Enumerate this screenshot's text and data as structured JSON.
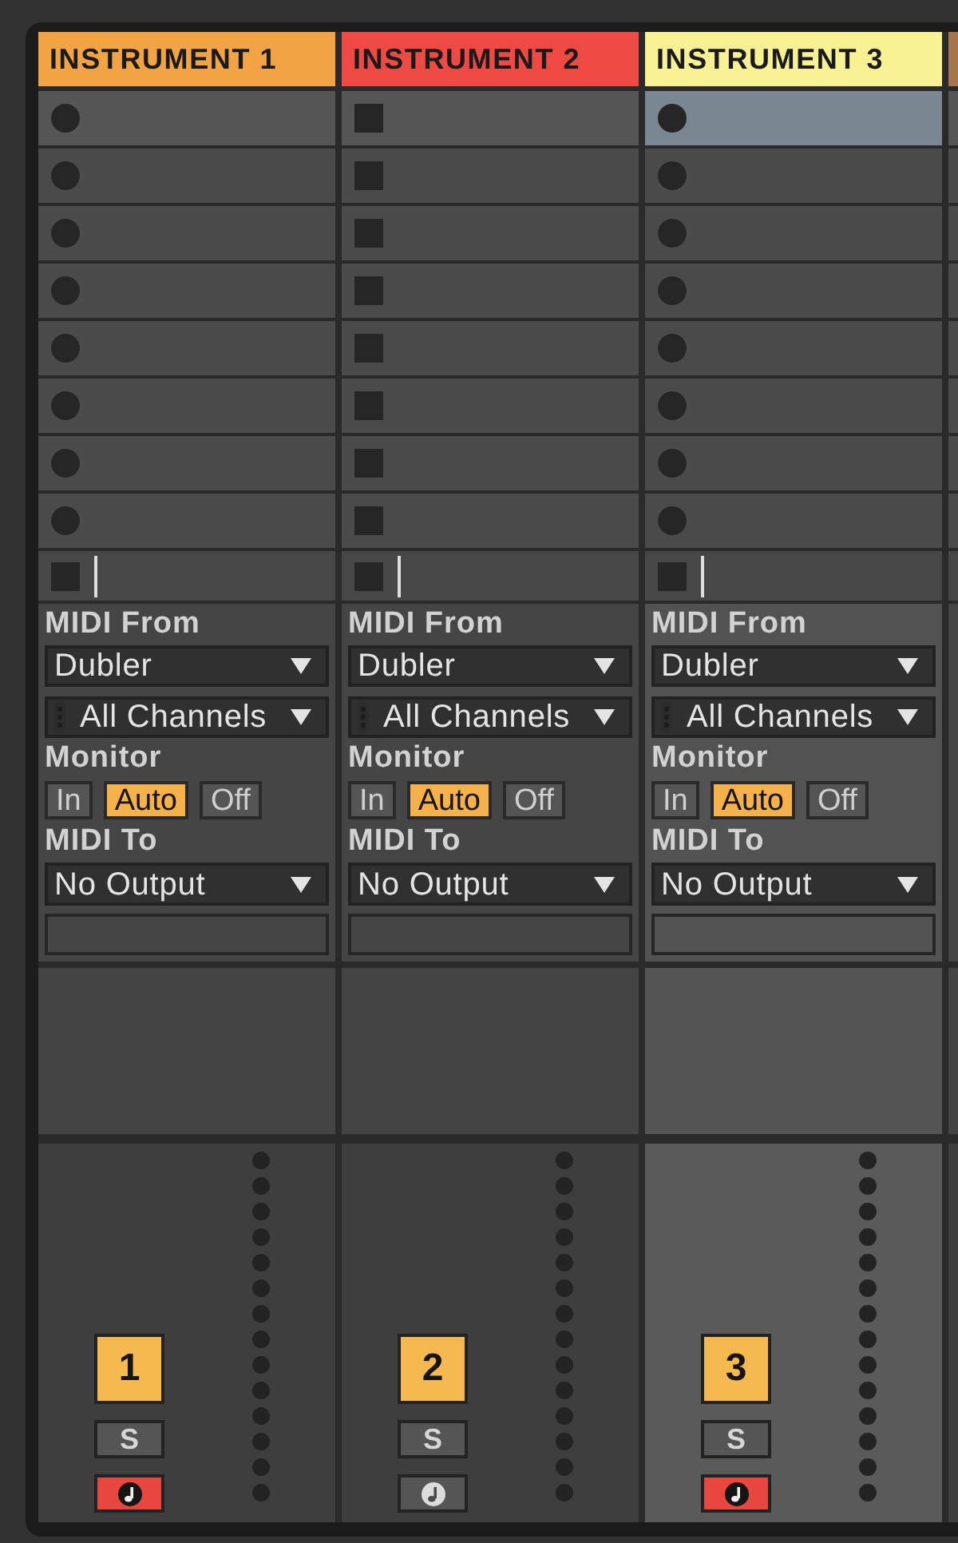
{
  "tracks": [
    {
      "kind": "track",
      "name": "INSTRUMENT 1",
      "color": "#f2a444",
      "selected": false,
      "slots": [
        {
          "selected": false
        },
        {
          "selected": false
        },
        {
          "selected": false
        },
        {
          "selected": false
        },
        {
          "selected": false
        },
        {
          "selected": false
        },
        {
          "selected": false
        },
        {
          "selected": false
        }
      ],
      "io": {
        "midi_from_label": "MIDI From",
        "midi_from": "Dubler",
        "channel": "All Channels",
        "monitor_label": "Monitor",
        "monitor": [
          {
            "label": "In",
            "selected": false
          },
          {
            "label": "Auto",
            "selected": true
          },
          {
            "label": "Off",
            "selected": false
          }
        ],
        "midi_to_label": "MIDI To",
        "midi_to": "No Output"
      },
      "mixer": {
        "number": "1",
        "active": true,
        "solo": "S",
        "soloed": false,
        "armed": true
      }
    },
    {
      "kind": "track",
      "name": "INSTRUMENT 2",
      "color": "#ee4a43",
      "selected": false,
      "slots": [
        {
          "selected": false
        },
        {
          "selected": false
        },
        {
          "selected": false
        },
        {
          "selected": false
        },
        {
          "selected": false
        },
        {
          "selected": false
        },
        {
          "selected": false
        },
        {
          "selected": false
        }
      ],
      "io": {
        "midi_from_label": "MIDI From",
        "midi_from": "Dubler",
        "channel": "All Channels",
        "monitor_label": "Monitor",
        "monitor": [
          {
            "label": "In",
            "selected": false
          },
          {
            "label": "Auto",
            "selected": true
          },
          {
            "label": "Off",
            "selected": false
          }
        ],
        "midi_to_label": "MIDI To",
        "midi_to": "No Output"
      },
      "mixer": {
        "number": "2",
        "active": true,
        "solo": "S",
        "soloed": false,
        "armed": false
      }
    },
    {
      "kind": "track",
      "name": "INSTRUMENT 3",
      "color": "#f7f193",
      "selected": true,
      "slots": [
        {
          "selected": true
        },
        {
          "selected": false
        },
        {
          "selected": false
        },
        {
          "selected": false
        },
        {
          "selected": false
        },
        {
          "selected": false
        },
        {
          "selected": false
        },
        {
          "selected": false
        }
      ],
      "io": {
        "midi_from_label": "MIDI From",
        "midi_from": "Dubler",
        "channel": "All Channels",
        "monitor_label": "Monitor",
        "monitor": [
          {
            "label": "In",
            "selected": false
          },
          {
            "label": "Auto",
            "selected": true
          },
          {
            "label": "Off",
            "selected": false
          }
        ],
        "midi_to_label": "MIDI To",
        "midi_to": "No Output"
      },
      "mixer": {
        "number": "3",
        "active": true,
        "solo": "S",
        "soloed": false,
        "armed": true
      }
    },
    {
      "kind": "edge",
      "color": "#a5764e"
    }
  ]
}
